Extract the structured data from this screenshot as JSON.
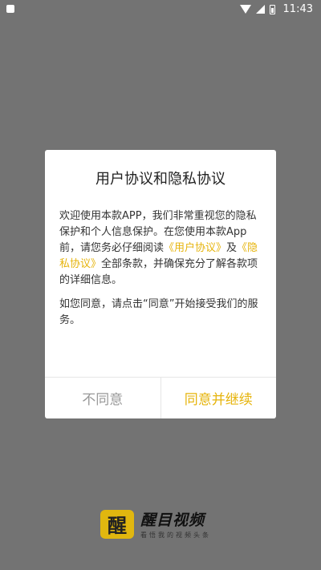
{
  "status_bar": {
    "time": "11:43"
  },
  "dialog": {
    "title": "用户协议和隐私协议",
    "p1_a": "欢迎使用本款APP，我们非常重视您的隐私保护和个人信息保护。在您使用本款App前，请您务必仔细阅读",
    "link_user_agreement": "《用户协议》",
    "p1_and": "及",
    "link_privacy_agreement": "《隐私协议》",
    "p1_b": "全部条款，并确保充分了解各款项的详细信息。",
    "p2": "如您同意，请点击“同意”开始接受我们的服务。",
    "disagree_label": "不同意",
    "agree_label": "同意并继续"
  },
  "brand": {
    "logo_char": "醒",
    "name": "醒目视频",
    "slogan": "看悟我的视频头条"
  },
  "colors": {
    "accent": "#e6b40c",
    "overlay": "#737373"
  },
  "icons": [
    "app-notification-icon",
    "wifi-icon",
    "signal-icon",
    "battery-icon"
  ]
}
